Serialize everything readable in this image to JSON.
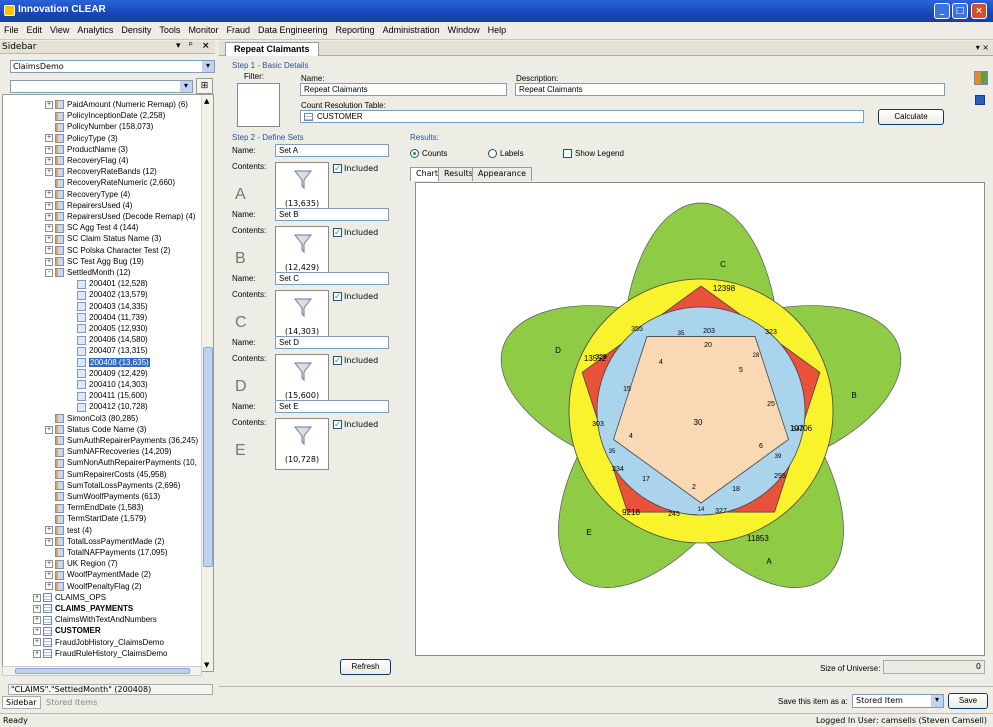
{
  "window": {
    "title": "Innovation CLEAR"
  },
  "menu": [
    "File",
    "Edit",
    "View",
    "Analytics",
    "Density",
    "Tools",
    "Monitor",
    "Fraud",
    "Data Engineering",
    "Reporting",
    "Administration",
    "Window",
    "Help"
  ],
  "sidebar": {
    "title": "Sidebar",
    "dataset": "ClaimsDemo",
    "tree": [
      {
        "label": "PaidAmount (Numeric Remap) (6)",
        "lvl": 1,
        "exp": "+",
        "icon": "field"
      },
      {
        "label": "PolicyInceptionDate (2,258)",
        "lvl": 1,
        "exp": "",
        "icon": "field"
      },
      {
        "label": "PolicyNumber (158,073)",
        "lvl": 1,
        "exp": "",
        "icon": "field"
      },
      {
        "label": "PolicyType (3)",
        "lvl": 1,
        "exp": "+",
        "icon": "field"
      },
      {
        "label": "ProductName (3)",
        "lvl": 1,
        "exp": "+",
        "icon": "field"
      },
      {
        "label": "RecoveryFlag (4)",
        "lvl": 1,
        "exp": "+",
        "icon": "field"
      },
      {
        "label": "RecoveryRateBands (12)",
        "lvl": 1,
        "exp": "+",
        "icon": "field"
      },
      {
        "label": "RecoveryRateNumeric (2,660)",
        "lvl": 1,
        "exp": "",
        "icon": "field"
      },
      {
        "label": "RecoveryType (4)",
        "lvl": 1,
        "exp": "+",
        "icon": "field"
      },
      {
        "label": "RepairersUsed (4)",
        "lvl": 1,
        "exp": "+",
        "icon": "field"
      },
      {
        "label": "RepairersUsed (Decode Remap) (4)",
        "lvl": 1,
        "exp": "+",
        "icon": "field"
      },
      {
        "label": "SC Agg Test 4 (144)",
        "lvl": 1,
        "exp": "+",
        "icon": "field"
      },
      {
        "label": "SC Claim Status Name (3)",
        "lvl": 1,
        "exp": "+",
        "icon": "field"
      },
      {
        "label": "SC Polska Character Test (2)",
        "lvl": 1,
        "exp": "+",
        "icon": "field"
      },
      {
        "label": "SC Test Agg Bug (19)",
        "lvl": 1,
        "exp": "+",
        "icon": "field"
      },
      {
        "label": "SettledMonth (12)",
        "lvl": 1,
        "exp": "-",
        "icon": "field"
      },
      {
        "label": "200401 (12,528)",
        "lvl": 2,
        "exp": "",
        "icon": "val"
      },
      {
        "label": "200402 (13,579)",
        "lvl": 2,
        "exp": "",
        "icon": "val"
      },
      {
        "label": "200403 (14,335)",
        "lvl": 2,
        "exp": "",
        "icon": "val"
      },
      {
        "label": "200404 (11,739)",
        "lvl": 2,
        "exp": "",
        "icon": "val"
      },
      {
        "label": "200405 (12,930)",
        "lvl": 2,
        "exp": "",
        "icon": "val"
      },
      {
        "label": "200406 (14,580)",
        "lvl": 2,
        "exp": "",
        "icon": "val"
      },
      {
        "label": "200407 (13,315)",
        "lvl": 2,
        "exp": "",
        "icon": "val"
      },
      {
        "label": "200408 (13,635)",
        "lvl": 2,
        "exp": "",
        "icon": "val",
        "sel": true
      },
      {
        "label": "200409 (12,429)",
        "lvl": 2,
        "exp": "",
        "icon": "val"
      },
      {
        "label": "200410 (14,303)",
        "lvl": 2,
        "exp": "",
        "icon": "val"
      },
      {
        "label": "200411 (15,600)",
        "lvl": 2,
        "exp": "",
        "icon": "val"
      },
      {
        "label": "200412 (10,728)",
        "lvl": 2,
        "exp": "",
        "icon": "val"
      },
      {
        "label": "SimonCol3 (80,285)",
        "lvl": 1,
        "exp": "",
        "icon": "field"
      },
      {
        "label": "Status Code Name (3)",
        "lvl": 1,
        "exp": "+",
        "icon": "field"
      },
      {
        "label": "SumAuthRepairerPayments (36,245)",
        "lvl": 1,
        "exp": "",
        "icon": "field"
      },
      {
        "label": "SumNAFRecoveries (14,209)",
        "lvl": 1,
        "exp": "",
        "icon": "field"
      },
      {
        "label": "SumNonAuthRepairerPayments (10,",
        "lvl": 1,
        "exp": "",
        "icon": "field"
      },
      {
        "label": "SumRepairerCosts (45,958)",
        "lvl": 1,
        "exp": "",
        "icon": "field"
      },
      {
        "label": "SumTotalLossPayments (2,696)",
        "lvl": 1,
        "exp": "",
        "icon": "field"
      },
      {
        "label": "SumWoolfPayments (613)",
        "lvl": 1,
        "exp": "",
        "icon": "field"
      },
      {
        "label": "TermEndDate (1,583)",
        "lvl": 1,
        "exp": "",
        "icon": "field"
      },
      {
        "label": "TermStartDate (1,579)",
        "lvl": 1,
        "exp": "",
        "icon": "field"
      },
      {
        "label": "test (4)",
        "lvl": 1,
        "exp": "+",
        "icon": "field"
      },
      {
        "label": "TotalLossPaymentMade (2)",
        "lvl": 1,
        "exp": "+",
        "icon": "field"
      },
      {
        "label": "TotalNAFPayments (17,095)",
        "lvl": 1,
        "exp": "",
        "icon": "field"
      },
      {
        "label": "UK Region (7)",
        "lvl": 1,
        "exp": "+",
        "icon": "field"
      },
      {
        "label": "WoolfPaymentMade (2)",
        "lvl": 1,
        "exp": "+",
        "icon": "field"
      },
      {
        "label": "WoolfPenaltyFlag (2)",
        "lvl": 1,
        "exp": "+",
        "icon": "field"
      },
      {
        "label": "CLAIMS_OPS",
        "lvl": 0,
        "exp": "+",
        "icon": "tbl"
      },
      {
        "label": "CLAIMS_PAYMENTS",
        "lvl": 0,
        "exp": "+",
        "icon": "tbl",
        "bold": true
      },
      {
        "label": "ClaimsWithTextAndNumbers",
        "lvl": 0,
        "exp": "+",
        "icon": "tbl"
      },
      {
        "label": "CUSTOMER",
        "lvl": 0,
        "exp": "+",
        "icon": "tbl",
        "bold": true
      },
      {
        "label": "FraudJobHistory_ClaimsDemo",
        "lvl": 0,
        "exp": "+",
        "icon": "tbl"
      },
      {
        "label": "FraudRuleHistory_ClaimsDemo",
        "lvl": 0,
        "exp": "+",
        "icon": "tbl"
      }
    ],
    "selection_path": "\"CLAIMS\".\"SettledMonth\" (200408)",
    "tabs": [
      "Sidebar",
      "Stored Items"
    ]
  },
  "editor": {
    "tab": "Repeat Claimants",
    "step1": "Step 1 - Basic Details",
    "filter_label": "Filter:",
    "name_label": "Name:",
    "name_value": "Repeat Claimants",
    "desc_label": "Description:",
    "desc_value": "Repeat Claimants",
    "count_table_label": "Count Resolution Table:",
    "count_table_value": "CUSTOMER",
    "calculate": "Calculate",
    "step2": "Step 2 - Define Sets",
    "sets": [
      {
        "name": "Set A",
        "letter": "A",
        "count": "(13,635)"
      },
      {
        "name": "Set B",
        "letter": "B",
        "count": "(12,429)"
      },
      {
        "name": "Set C",
        "letter": "C",
        "count": "(14,303)"
      },
      {
        "name": "Set D",
        "letter": "D",
        "count": "(15,600)"
      },
      {
        "name": "Set E",
        "letter": "E",
        "count": "(10,728)"
      }
    ],
    "set_name_label": "Name:",
    "contents_label": "Contents:",
    "included_label": "Included",
    "refresh": "Refresh",
    "results_label": "Results:",
    "counts_label": "Counts",
    "labels_label": "Labels",
    "show_legend": "Show Legend",
    "subtabs": [
      "Chart",
      "Results",
      "Appearance"
    ],
    "universe_label": "Size of Universe:",
    "universe_value": "0",
    "save_as_label": "Save this item as a:",
    "save_type": "Stored Item",
    "save": "Save"
  },
  "venn": {
    "set_labels": [
      "A",
      "B",
      "C",
      "D",
      "E"
    ],
    "outer": {
      "C": "12398",
      "B": "10706",
      "A": "11853",
      "E": "9218",
      "D": "13552"
    },
    "ring2": [
      "355",
      "203",
      "323",
      "342",
      "295",
      "327",
      "245",
      "234",
      "303",
      "329"
    ],
    "ring3": [
      "20",
      "25",
      "18",
      "17",
      "15"
    ],
    "ring3_small": [
      "35",
      "28",
      "39",
      "14",
      "35"
    ],
    "inner": [
      "4",
      "5",
      "6",
      "2",
      "4"
    ],
    "center": "30",
    "colors": {
      "green": "#8fcb45",
      "yellow": "#f8f32c",
      "red": "#e9513a",
      "blue": "#a9d4ec",
      "peach": "#f8d9b4"
    }
  },
  "status": {
    "left": "Ready",
    "right": "Logged In User: camsells (Steven Camsell)"
  }
}
